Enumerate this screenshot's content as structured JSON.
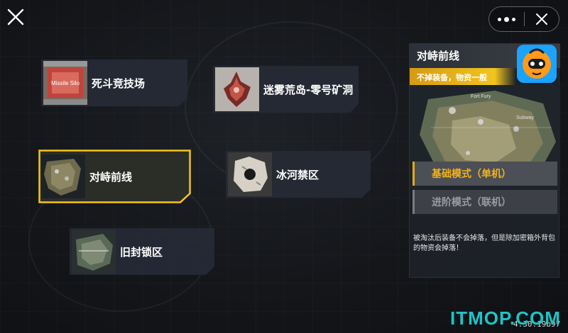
{
  "maps": [
    {
      "name": "死斗竞技场",
      "thumb_text": "Missile Silo"
    },
    {
      "name": "迷雾荒岛-零号矿洞"
    },
    {
      "name": "对峙前线",
      "selected": true
    },
    {
      "name": "冰河禁区"
    },
    {
      "name": "旧封锁区"
    }
  ],
  "detail": {
    "title": "对峙前线",
    "subtitle": "不掉装备，物资一般",
    "map_labels": [
      "Fort Fury",
      "Subway"
    ],
    "modes": [
      {
        "label": "基础模式（单机）",
        "active": true
      },
      {
        "label": "进阶模式（联机）",
        "active": false
      }
    ],
    "description": "被淘汰后装备不会掉落，但是除加密箱外背包的物资会掉落！"
  },
  "version": "4.30.19b97",
  "watermark": "ITMOP.COM",
  "icons": {
    "close": "close-x-icon",
    "more": "more-dots-icon",
    "exit": "close-icon",
    "logo": "app-mascot-logo"
  },
  "colors": {
    "accent": "#f2b21e",
    "selected_outline": "#f5c518",
    "card_bg": "#262a36",
    "watermark": "#1fc3c9"
  }
}
